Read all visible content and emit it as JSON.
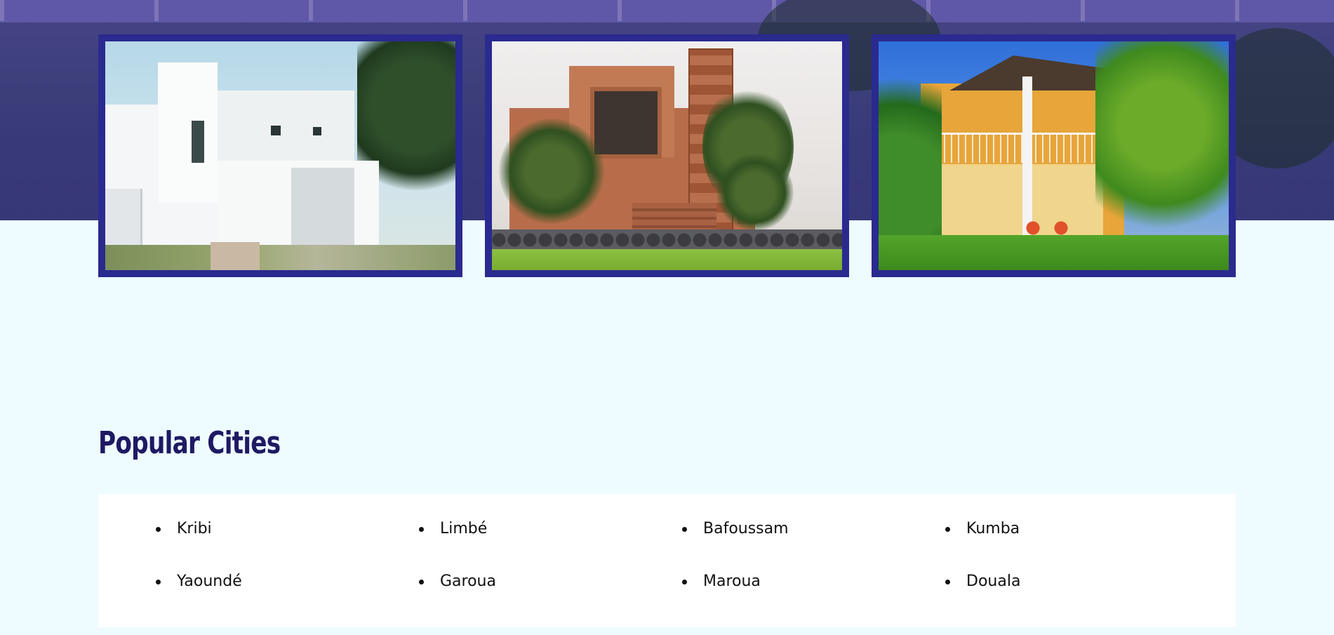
{
  "gallery": {
    "images": [
      {
        "alt": "Modern white house"
      },
      {
        "alt": "Terracotta villa with carved panels"
      },
      {
        "alt": "Yellow two-storey house with balcony"
      }
    ]
  },
  "popular_cities": {
    "title": "Popular Cities",
    "cities": [
      "Kribi",
      "Limbé",
      "Bafoussam",
      "Kumba",
      "Yaoundé",
      "Garoua",
      "Maroua",
      "Douala"
    ]
  },
  "colors": {
    "accent": "#2a2a8f",
    "title": "#1e1a63",
    "page_bg": "#eefbff"
  }
}
